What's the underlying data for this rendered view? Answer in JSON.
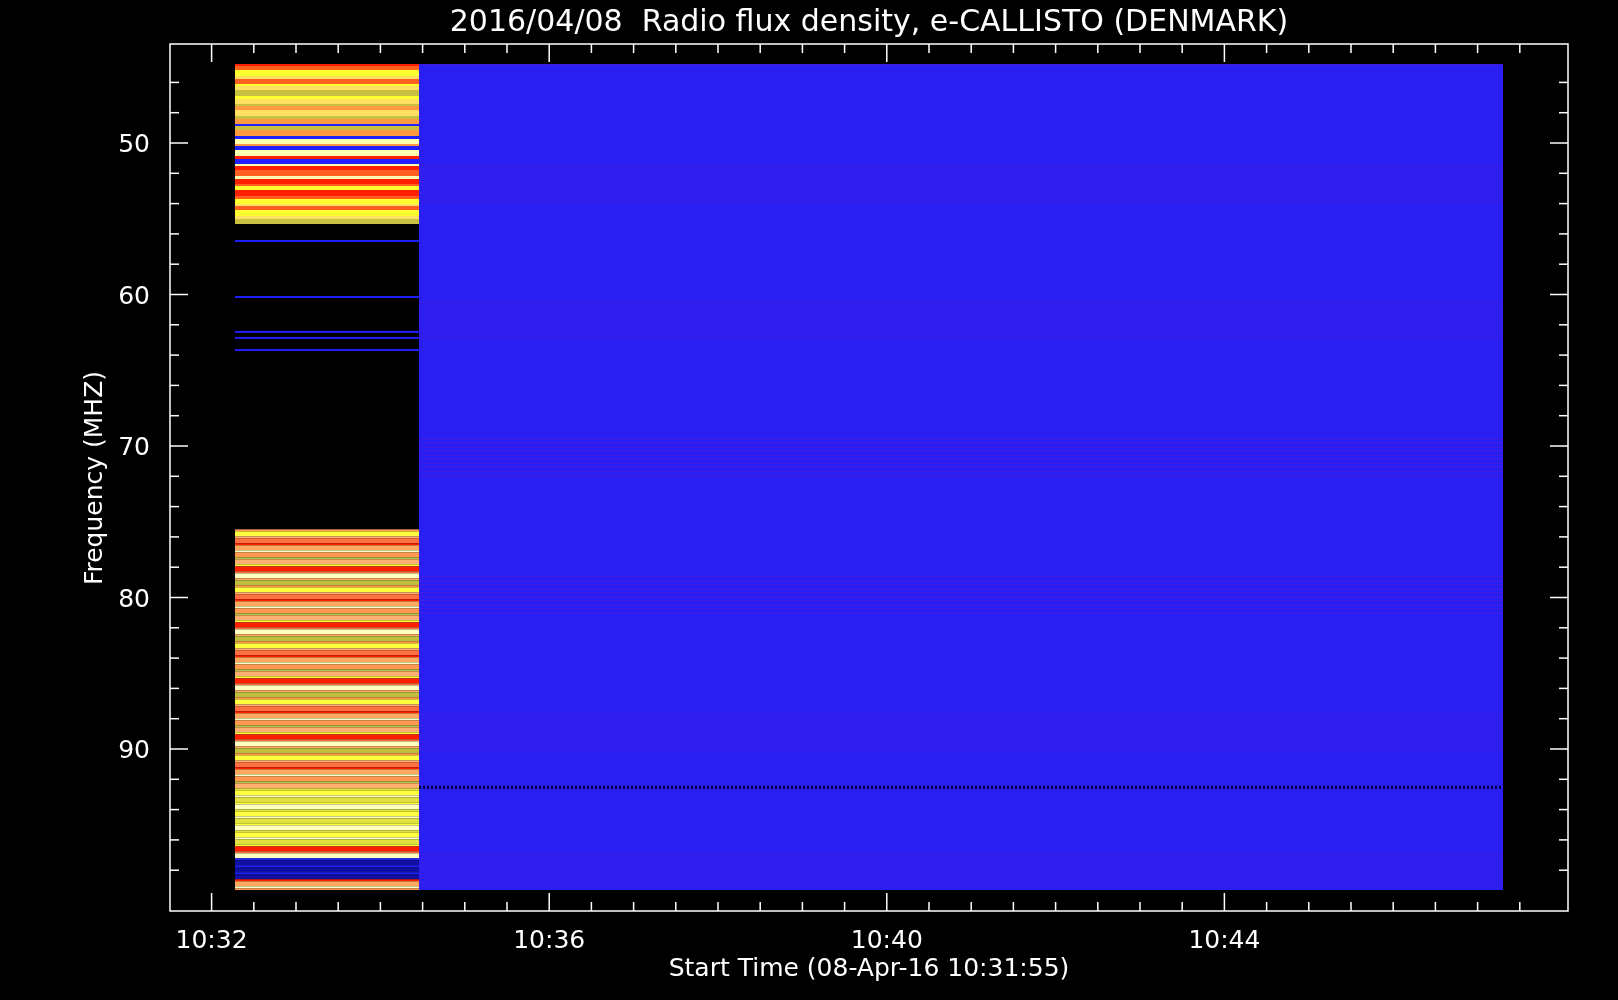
{
  "plot": {
    "title": "2016/04/08  Radio flux density, e-CALLISTO (DENMARK)",
    "xlabel": "Start Time (08-Apr-16 10:31:55)",
    "ylabel": "Frequency (MHZ)",
    "xtick_labels": [
      "10:32",
      "10:36",
      "10:40",
      "10:44"
    ],
    "ytick_labels": [
      "50",
      "60",
      "70",
      "80",
      "90"
    ]
  }
}
